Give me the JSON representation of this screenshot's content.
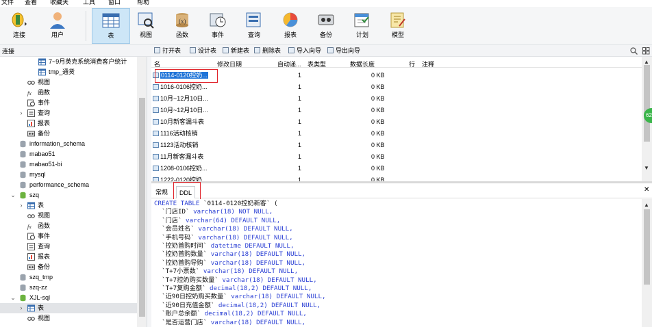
{
  "menu": [
    "文件",
    "查看",
    "收藏夹",
    "工具",
    "窗口",
    "帮助"
  ],
  "toolbar": {
    "connect": "连接",
    "user": "用户",
    "table": "表",
    "view": "视图",
    "function": "函数",
    "event": "事件",
    "query": "查询",
    "report": "报表",
    "backup": "备份",
    "schedule": "计划",
    "model": "模型"
  },
  "sidebar": {
    "title": "连接"
  },
  "actions": {
    "open": "打开表",
    "design": "设计表",
    "new": "新建表",
    "delete": "删除表",
    "import": "导入向导",
    "export": "导出向导"
  },
  "tree": [
    {
      "label": "7~9月英克系统消费客户统计",
      "indent": 4,
      "icon": "table-icon",
      "tw": ""
    },
    {
      "label": "tmp_通货",
      "indent": 4,
      "icon": "table-icon",
      "tw": ""
    },
    {
      "label": "视图",
      "indent": 3,
      "icon": "view-icon",
      "tw": ""
    },
    {
      "label": "函数",
      "indent": 3,
      "icon": "function-icon",
      "tw": ""
    },
    {
      "label": "事件",
      "indent": 3,
      "icon": "event-icon",
      "tw": ""
    },
    {
      "label": "查询",
      "indent": 3,
      "icon": "query-icon",
      "tw": "›"
    },
    {
      "label": "报表",
      "indent": 3,
      "icon": "report-icon",
      "tw": ""
    },
    {
      "label": "备份",
      "indent": 3,
      "icon": "backup-icon",
      "tw": ""
    },
    {
      "label": "information_schema",
      "indent": 2,
      "icon": "database-icon",
      "tw": ""
    },
    {
      "label": "mabao51",
      "indent": 2,
      "icon": "database-icon",
      "tw": ""
    },
    {
      "label": "mabao51-bi",
      "indent": 2,
      "icon": "database-icon",
      "tw": ""
    },
    {
      "label": "mysql",
      "indent": 2,
      "icon": "database-icon",
      "tw": ""
    },
    {
      "label": "performance_schema",
      "indent": 2,
      "icon": "database-icon",
      "tw": ""
    },
    {
      "label": "szq",
      "indent": 2,
      "icon": "database-open-icon",
      "tw": "⌄"
    },
    {
      "label": "表",
      "indent": 3,
      "icon": "table-folder-icon",
      "tw": "›"
    },
    {
      "label": "视图",
      "indent": 3,
      "icon": "view-icon",
      "tw": ""
    },
    {
      "label": "函数",
      "indent": 3,
      "icon": "function-icon",
      "tw": ""
    },
    {
      "label": "事件",
      "indent": 3,
      "icon": "event-icon",
      "tw": ""
    },
    {
      "label": "查询",
      "indent": 3,
      "icon": "query-icon",
      "tw": ""
    },
    {
      "label": "报表",
      "indent": 3,
      "icon": "report-icon",
      "tw": ""
    },
    {
      "label": "备份",
      "indent": 3,
      "icon": "backup-icon",
      "tw": ""
    },
    {
      "label": "szq_tmp",
      "indent": 2,
      "icon": "database-icon",
      "tw": ""
    },
    {
      "label": "szq-zz",
      "indent": 2,
      "icon": "database-icon",
      "tw": ""
    },
    {
      "label": "XJL-sql",
      "indent": 2,
      "icon": "database-open-icon",
      "tw": "⌄"
    },
    {
      "label": "表",
      "indent": 3,
      "icon": "table-folder-icon",
      "tw": "›",
      "selected": true
    },
    {
      "label": "视图",
      "indent": 3,
      "icon": "view-icon",
      "tw": ""
    }
  ],
  "columns": [
    "名",
    "修改日期",
    "自动递...",
    "表类型",
    "数据长度",
    "行",
    "注释"
  ],
  "tables": [
    {
      "name": "0114-0120控奶...",
      "auto": "1",
      "size": "0 KB",
      "selected": true
    },
    {
      "name": "1016-0106控奶...",
      "auto": "1",
      "size": "0 KB"
    },
    {
      "name": "10月~12月10日...",
      "auto": "1",
      "size": "0 KB"
    },
    {
      "name": "10月~12月10日...",
      "auto": "1",
      "size": "0 KB"
    },
    {
      "name": "10月新客漏斗表",
      "auto": "1",
      "size": "0 KB"
    },
    {
      "name": "1116活动核销",
      "auto": "1",
      "size": "0 KB"
    },
    {
      "name": "1123活动核销",
      "auto": "1",
      "size": "0 KB"
    },
    {
      "name": "11月新客漏斗表",
      "auto": "1",
      "size": "0 KB"
    },
    {
      "name": "1208-0106控奶...",
      "auto": "1",
      "size": "0 KB"
    },
    {
      "name": "1222-0120控奶...",
      "auto": "1",
      "size": "0 KB"
    }
  ],
  "tabs": [
    "常规",
    "DDL"
  ],
  "badge": "62",
  "ddl_lines": [
    [
      [
        "kw",
        "CREATE TABLE "
      ],
      [
        "str",
        "`0114-0120控奶新客` ("
      ]
    ],
    [
      [
        "str",
        "  `门店ID` "
      ],
      [
        "kw",
        "varchar(18) NOT NULL,"
      ]
    ],
    [
      [
        "str",
        "  `门店` "
      ],
      [
        "kw",
        "varchar(64) DEFAULT NULL,"
      ]
    ],
    [
      [
        "str",
        "  `会员姓名` "
      ],
      [
        "kw",
        "varchar(18) DEFAULT NULL,"
      ]
    ],
    [
      [
        "str",
        "  `手机号码` "
      ],
      [
        "kw",
        "varchar(18) DEFAULT NULL,"
      ]
    ],
    [
      [
        "str",
        "  `控奶首购时间` "
      ],
      [
        "kw",
        "datetime DEFAULT NULL,"
      ]
    ],
    [
      [
        "str",
        "  `控奶首购数量` "
      ],
      [
        "kw",
        "varchar(18) DEFAULT NULL,"
      ]
    ],
    [
      [
        "str",
        "  `控奶首购导购` "
      ],
      [
        "kw",
        "varchar(18) DEFAULT NULL,"
      ]
    ],
    [
      [
        "str",
        "  `T+7小票数` "
      ],
      [
        "kw",
        "varchar(18) DEFAULT NULL,"
      ]
    ],
    [
      [
        "str",
        "  `T+7控奶购买数量` "
      ],
      [
        "kw",
        "varchar(18) DEFAULT NULL,"
      ]
    ],
    [
      [
        "str",
        "  `T+7复购金额` "
      ],
      [
        "kw",
        "decimal(18,2) DEFAULT NULL,"
      ]
    ],
    [
      [
        "str",
        "  `近90日控奶购买数量` "
      ],
      [
        "kw",
        "varchar(18) DEFAULT NULL,"
      ]
    ],
    [
      [
        "str",
        "  `近90日充值金额` "
      ],
      [
        "kw",
        "decimal(18,2) DEFAULT NULL,"
      ]
    ],
    [
      [
        "str",
        "  `账户总余额` "
      ],
      [
        "kw",
        "decimal(18,2) DEFAULT NULL,"
      ]
    ],
    [
      [
        "str",
        "  `是否运营门店` "
      ],
      [
        "kw",
        "varchar(18) DEFAULT NULL,"
      ]
    ]
  ]
}
